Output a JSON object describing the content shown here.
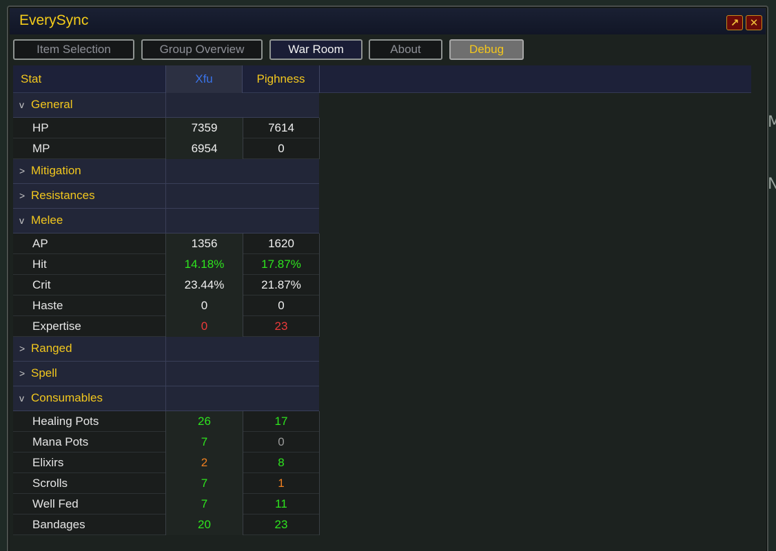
{
  "window": {
    "title": "EverySync"
  },
  "outside": {
    "glyph1": "M",
    "glyph2": "N"
  },
  "tabs": [
    {
      "label": "Item Selection",
      "state": "normal"
    },
    {
      "label": "Group Overview",
      "state": "normal"
    },
    {
      "label": "War Room",
      "state": "active"
    },
    {
      "label": "About",
      "state": "normal"
    },
    {
      "label": "Debug",
      "state": "highlight"
    }
  ],
  "table": {
    "headers": {
      "stat": "Stat",
      "col1": "Xfu",
      "col2": "Pighness"
    },
    "rows": [
      {
        "type": "section",
        "arrow": "v",
        "label": "General"
      },
      {
        "type": "stat",
        "name": "HP",
        "v1": "7359",
        "c1": "white",
        "v2": "7614",
        "c2": "white"
      },
      {
        "type": "stat",
        "name": "MP",
        "v1": "6954",
        "c1": "white",
        "v2": "0",
        "c2": "white"
      },
      {
        "type": "section",
        "arrow": ">",
        "label": "Mitigation"
      },
      {
        "type": "section",
        "arrow": ">",
        "label": "Resistances"
      },
      {
        "type": "section",
        "arrow": "v",
        "label": "Melee"
      },
      {
        "type": "stat",
        "name": "AP",
        "v1": "1356",
        "c1": "white",
        "v2": "1620",
        "c2": "white"
      },
      {
        "type": "stat",
        "name": "Hit",
        "v1": "14.18%",
        "c1": "green",
        "v2": "17.87%",
        "c2": "green"
      },
      {
        "type": "stat",
        "name": "Crit",
        "v1": "23.44%",
        "c1": "white",
        "v2": "21.87%",
        "c2": "white"
      },
      {
        "type": "stat",
        "name": "Haste",
        "v1": "0",
        "c1": "white",
        "v2": "0",
        "c2": "white"
      },
      {
        "type": "stat",
        "name": "Expertise",
        "v1": "0",
        "c1": "red",
        "v2": "23",
        "c2": "red"
      },
      {
        "type": "section",
        "arrow": ">",
        "label": "Ranged"
      },
      {
        "type": "section",
        "arrow": ">",
        "label": "Spell"
      },
      {
        "type": "section",
        "arrow": "v",
        "label": "Consumables"
      },
      {
        "type": "stat",
        "name": "Healing Pots",
        "v1": "26",
        "c1": "green",
        "v2": "17",
        "c2": "green"
      },
      {
        "type": "stat",
        "name": "Mana Pots",
        "v1": "7",
        "c1": "green",
        "v2": "0",
        "c2": "grey"
      },
      {
        "type": "stat",
        "name": "Elixirs",
        "v1": "2",
        "c1": "orange",
        "v2": "8",
        "c2": "green"
      },
      {
        "type": "stat",
        "name": "Scrolls",
        "v1": "7",
        "c1": "green",
        "v2": "1",
        "c2": "orange"
      },
      {
        "type": "stat",
        "name": "Well Fed",
        "v1": "7",
        "c1": "green",
        "v2": "11",
        "c2": "green"
      },
      {
        "type": "stat",
        "name": "Bandages",
        "v1": "20",
        "c1": "green",
        "v2": "23",
        "c2": "green"
      }
    ]
  },
  "colors": {
    "gold": "#f2c71e",
    "green": "#2ee61e",
    "red": "#ec3a3a",
    "orange": "#f08020",
    "blue": "#3a73e8"
  },
  "icons": {
    "popout": "popout-arrow-icon",
    "close": "close-x-icon"
  }
}
